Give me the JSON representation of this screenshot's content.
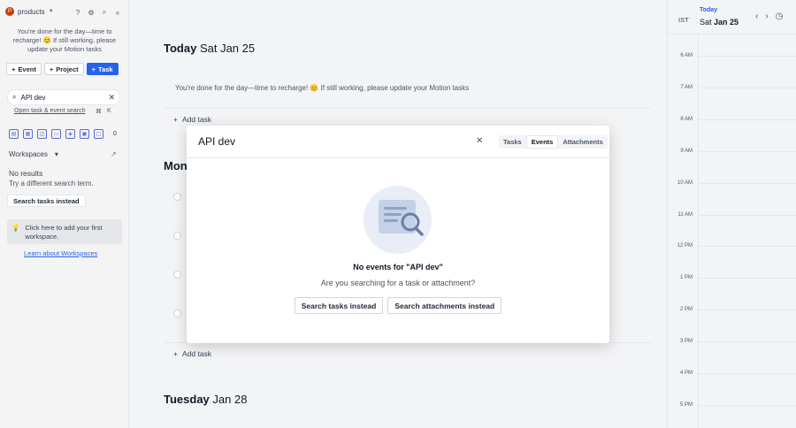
{
  "sidebar": {
    "workspace_initial": "P",
    "workspace_name": "products",
    "done_message": "You're done for the day—time to recharge! 😊 If still working, please update your Motion tasks",
    "buttons": {
      "event": "Event",
      "project": "Project",
      "task": "Task"
    },
    "search_value": "API dev",
    "open_search_link": "Open task & event search",
    "shortcut_keys": [
      "⌘",
      "K"
    ],
    "filter_count": "0",
    "workspaces_label": "Workspaces",
    "no_results": "No results",
    "try_different": "Try a different search term.",
    "search_tasks_instead": "Search tasks instead",
    "click_here": "Click here to add your first workspace.",
    "learn_link": "Learn about Workspaces"
  },
  "main": {
    "days": [
      {
        "weekday": "Today",
        "date": "Sat Jan 25"
      },
      {
        "weekday": "Mond",
        "date": ""
      },
      {
        "weekday": "Tuesday",
        "date": "Jan 28"
      }
    ],
    "today_message": "You're done for the day—time to recharge! 😊 If still working, please update your Motion tasks",
    "add_task_label": "Add task"
  },
  "calendar": {
    "timezone": "IST",
    "today_label": "Today",
    "weekday": "Sat",
    "date": "Jan 25",
    "hours": [
      "6 AM",
      "7 AM",
      "8 AM",
      "9 AM",
      "10 AM",
      "11 AM",
      "12 PM",
      "1 PM",
      "2 PM",
      "3 PM",
      "4 PM",
      "5 PM"
    ]
  },
  "modal": {
    "query": "API dev",
    "tabs": [
      "Tasks",
      "Events",
      "Attachments"
    ],
    "active_tab": "Events",
    "empty_title": "No events for \"API dev\"",
    "empty_subtitle": "Are you searching for a task or attachment?",
    "btn_tasks": "Search tasks instead",
    "btn_attachments": "Search attachments instead"
  }
}
